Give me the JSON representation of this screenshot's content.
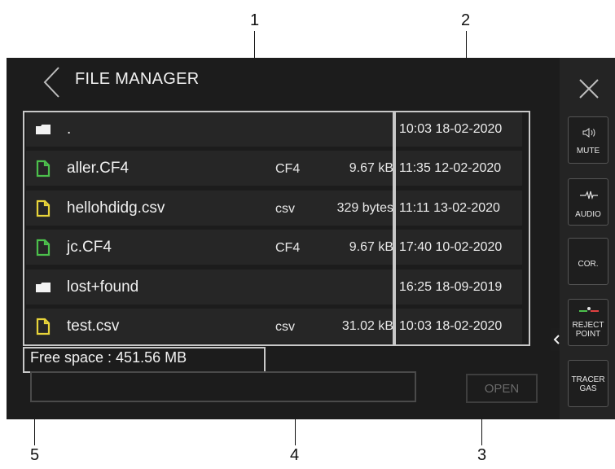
{
  "header": {
    "title": "FILE MANAGER"
  },
  "files": [
    {
      "name": ".",
      "type": "",
      "size": "",
      "date": "10:03 18-02-2020",
      "icon": "folder-icon",
      "color": "#f2f2f2"
    },
    {
      "name": "aller.CF4",
      "type": "CF4",
      "size": "9.67 kB",
      "date": "11:35 12-02-2020",
      "icon": "file-icon",
      "color": "#4cc04c"
    },
    {
      "name": "hellohdidg.csv",
      "type": "csv",
      "size": "329 bytes",
      "date": "11:11 13-02-2020",
      "icon": "file-icon",
      "color": "#e8d43a"
    },
    {
      "name": "jc.CF4",
      "type": "CF4",
      "size": "9.67 kB",
      "date": "17:40 10-02-2020",
      "icon": "file-icon",
      "color": "#4cc04c"
    },
    {
      "name": "lost+found",
      "type": "",
      "size": "",
      "date": "16:25 18-09-2019",
      "icon": "folder-icon",
      "color": "#f2f2f2"
    },
    {
      "name": "test.csv",
      "type": "csv",
      "size": "31.02 kB",
      "date": "10:03 18-02-2020",
      "icon": "file-icon",
      "color": "#e8d43a"
    }
  ],
  "footer": {
    "free_space": "Free space : 451.56 MB",
    "filename_value": "",
    "open_label": "OPEN"
  },
  "sidebar": {
    "mute_label": "MUTE",
    "audio_label": "AUDIO",
    "cor_label": "COR.",
    "reject_label_1": "REJECT",
    "reject_label_2": "POINT",
    "tracer_label_1": "TRACER",
    "tracer_label_2": "GAS"
  },
  "callouts": {
    "c1": "1",
    "c2": "2",
    "c3": "3",
    "c4": "4",
    "c5": "5"
  }
}
